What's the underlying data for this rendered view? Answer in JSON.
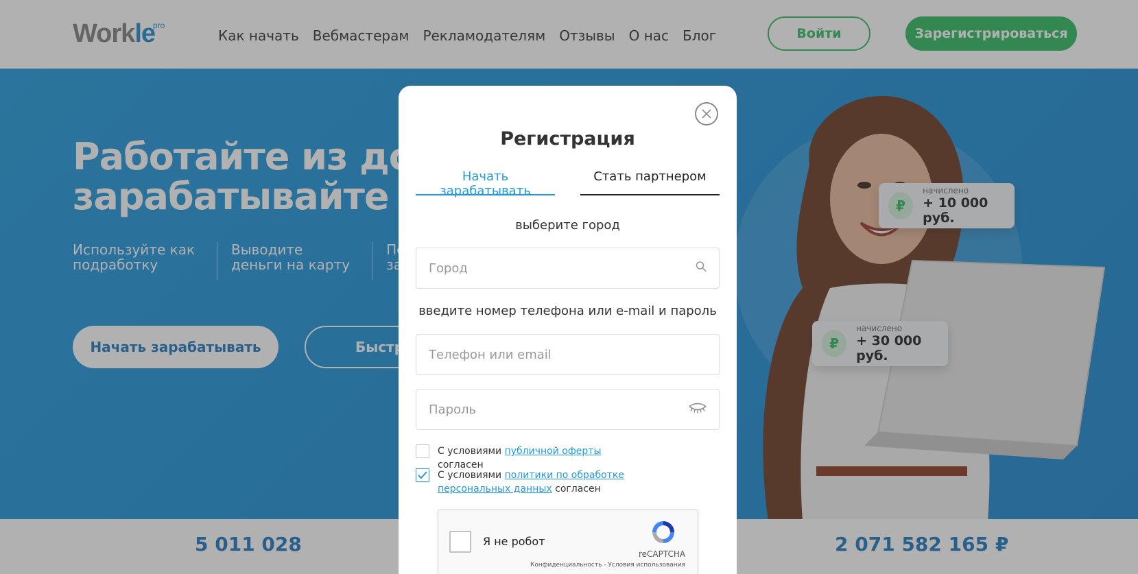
{
  "header": {
    "logo_main": "Work",
    "logo_accent": "le",
    "logo_sup": "pro",
    "nav": [
      "Как начать",
      "Вебмастерам",
      "Рекламодателям",
      "Отзывы",
      "О нас",
      "Блог"
    ],
    "login_label": "Войти",
    "register_label": "Зарегистрироваться"
  },
  "hero": {
    "title_line1": "Работайте из дома",
    "title_line2": "зарабатывайте в ин",
    "features": [
      {
        "line1": "Используйте как",
        "line2": "подработку"
      },
      {
        "line1": "Выводите",
        "line2": "деньги на карту"
      },
      {
        "line1": "Получ",
        "line2": "за пок"
      }
    ],
    "primary_button": "Начать зарабатывать",
    "secondary_button": "Быстр",
    "cards": [
      {
        "icon": "₽",
        "label": "начислено",
        "value": "+ 10 000 руб."
      },
      {
        "icon": "₽",
        "label": "начислено",
        "value": "+ 30 000 руб."
      }
    ]
  },
  "stats": {
    "left": "5 011 028",
    "right": "2 071 582 165 ₽"
  },
  "modal": {
    "title": "Регистрация",
    "tabs": [
      "Начать зарабатывать",
      "Стать партнером"
    ],
    "active_tab": "Начать зарабатывать",
    "city_label": "выберите город",
    "city_placeholder": "Город",
    "contact_label": "введите номер телефона или e-mail и пароль",
    "phone_placeholder": "Телефон или email",
    "password_placeholder": "Пароль",
    "offer_prefix": "С условиями ",
    "offer_link": "публичной оферты",
    "offer_suffix": " согласен",
    "offer_checked": false,
    "privacy_prefix": "С условиями ",
    "privacy_link": "политики по обработке персональных данных",
    "privacy_suffix": " согласен",
    "privacy_checked": true,
    "captcha_label": "Я не робот",
    "captcha_brand": "reCAPTCHA",
    "captcha_fine": "Конфиденциальность - Условия использования"
  },
  "colors": {
    "brand_green": "#2dbb61",
    "brand_blue": "#1f9ade",
    "hero_blue": "#1b8dd6"
  },
  "icons": {
    "close": "close-icon",
    "search": "search-icon",
    "eye": "eye-closed-icon",
    "check": "checkmark-icon",
    "recaptcha": "recaptcha-logo-icon"
  }
}
